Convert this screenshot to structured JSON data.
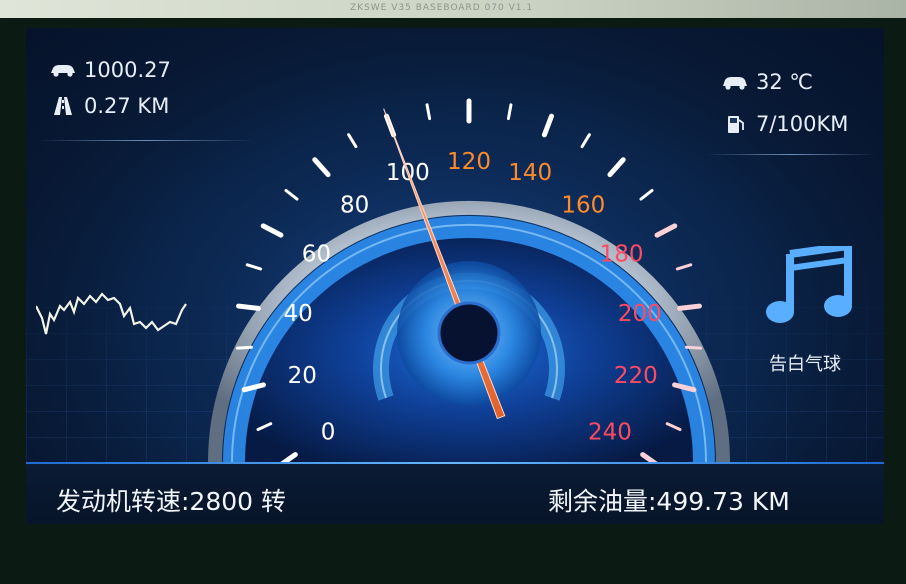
{
  "board": {
    "silk_text": "ZKSWE V35 BASEBOARD 070 V1.1"
  },
  "odometer": {
    "icon": "car-icon",
    "value": "1000.27"
  },
  "trip": {
    "icon": "road-icon",
    "value": "0.27 KM"
  },
  "temperature": {
    "icon": "car-temp-icon",
    "value": "32 ℃"
  },
  "consumption": {
    "icon": "fuel-pump-icon",
    "value": "7/100KM"
  },
  "music": {
    "icon": "music-note-icon",
    "song": "告白气球"
  },
  "speedometer": {
    "ticks": [
      {
        "label": "0",
        "value": 0,
        "color": "#ffffff"
      },
      {
        "label": "20",
        "value": 20,
        "color": "#ffffff"
      },
      {
        "label": "40",
        "value": 40,
        "color": "#ffffff"
      },
      {
        "label": "60",
        "value": 60,
        "color": "#ffffff"
      },
      {
        "label": "80",
        "value": 80,
        "color": "#ffffff"
      },
      {
        "label": "100",
        "value": 100,
        "color": "#ffffff"
      },
      {
        "label": "120",
        "value": 120,
        "color": "#ff8a2a"
      },
      {
        "label": "140",
        "value": 140,
        "color": "#ff8a2a"
      },
      {
        "label": "160",
        "value": 160,
        "color": "#ff8a2a"
      },
      {
        "label": "180",
        "value": 180,
        "color": "#ff4a62"
      },
      {
        "label": "200",
        "value": 200,
        "color": "#ff4a62"
      },
      {
        "label": "220",
        "value": 220,
        "color": "#ff4a62"
      },
      {
        "label": "240",
        "value": 240,
        "color": "#ff4a62"
      }
    ],
    "max": 240,
    "speed": 100
  },
  "status": {
    "rpm": "发动机转速:2800 转",
    "fuel": "剩余油量:499.73 KM"
  }
}
